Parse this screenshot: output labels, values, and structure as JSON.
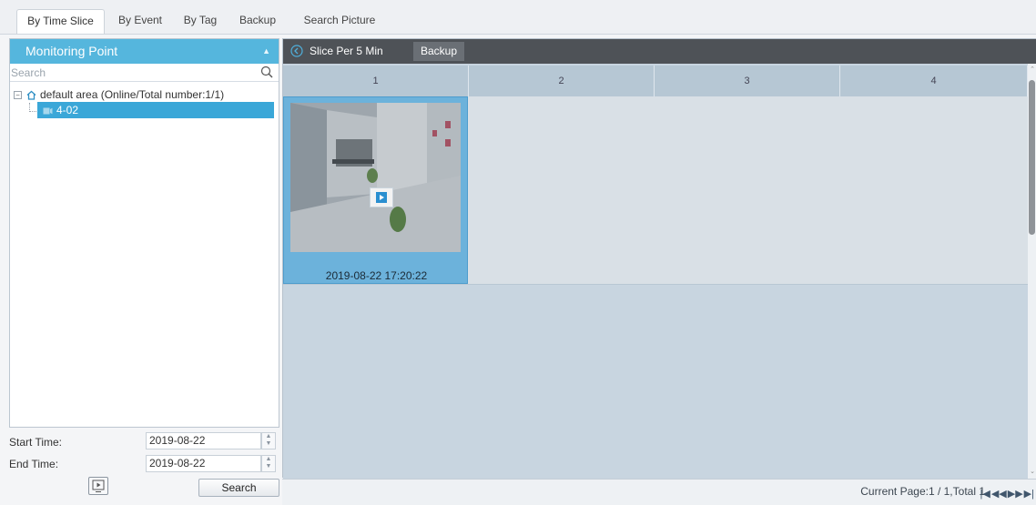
{
  "tabs": [
    {
      "label": "By Time Slice",
      "active": true
    },
    {
      "label": "By Event",
      "active": false
    },
    {
      "label": "By Tag",
      "active": false
    },
    {
      "label": "Backup",
      "active": false
    },
    {
      "label": "Search Picture",
      "active": false
    }
  ],
  "left_panel": {
    "title": "Monitoring Point",
    "search_placeholder": "Search",
    "area_label": "default area (Online/Total number:1/1)",
    "camera_label": "4-02"
  },
  "time": {
    "start_label": "Start Time:",
    "start_value": "2019-08-22",
    "end_label": "End Time:",
    "end_value": "2019-08-22",
    "search_label": "Search"
  },
  "toolbar": {
    "slice_label": "Slice Per 5 Min",
    "backup_label": "Backup"
  },
  "columns": [
    "1",
    "2",
    "3",
    "4"
  ],
  "results": [
    {
      "timestamp": "2019-08-22 17:20:22"
    }
  ],
  "footer": {
    "page_info": "Current Page:1 / 1,Total 1"
  },
  "colors": {
    "accent": "#55b6dd",
    "selected": "#3aa7d8",
    "toolbar": "#4e5257"
  },
  "icons": [
    "search-icon",
    "home-icon",
    "camera-icon",
    "back-icon",
    "play-icon",
    "preview-icon",
    "first-page-icon",
    "prev-page-icon",
    "next-page-icon",
    "last-page-icon"
  ]
}
